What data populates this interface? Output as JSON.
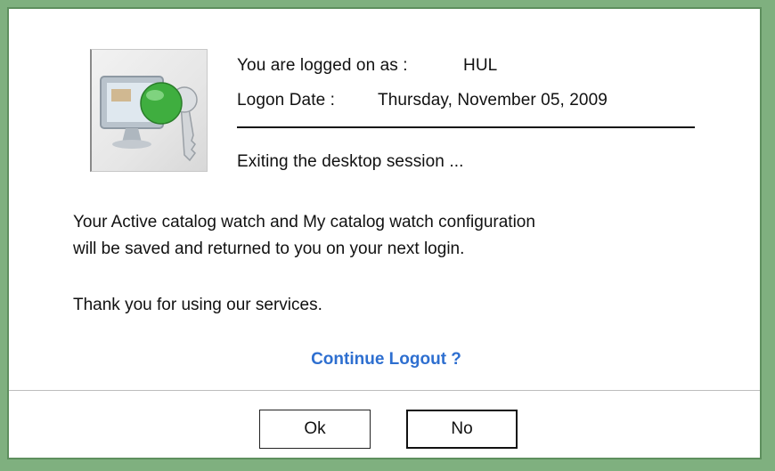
{
  "session": {
    "user_label": "You are logged on as :",
    "user_value": "HUL",
    "date_label": "Logon Date :",
    "date_value": "Thursday, November 05, 2009",
    "exit_text": "Exiting the desktop session ..."
  },
  "message": {
    "line1": "Your Active catalog watch  and  My catalog watch configuration",
    "line2": "will be saved and returned  to you on your next login.",
    "thanks": "Thank you for using our services."
  },
  "prompt": {
    "question": "Continue Logout ?"
  },
  "buttons": {
    "ok": "Ok",
    "no": "No"
  },
  "colors": {
    "frame": "#7fb07f",
    "link": "#2e6fd0"
  },
  "icons": {
    "logo": "logon-computer-key-icon"
  }
}
